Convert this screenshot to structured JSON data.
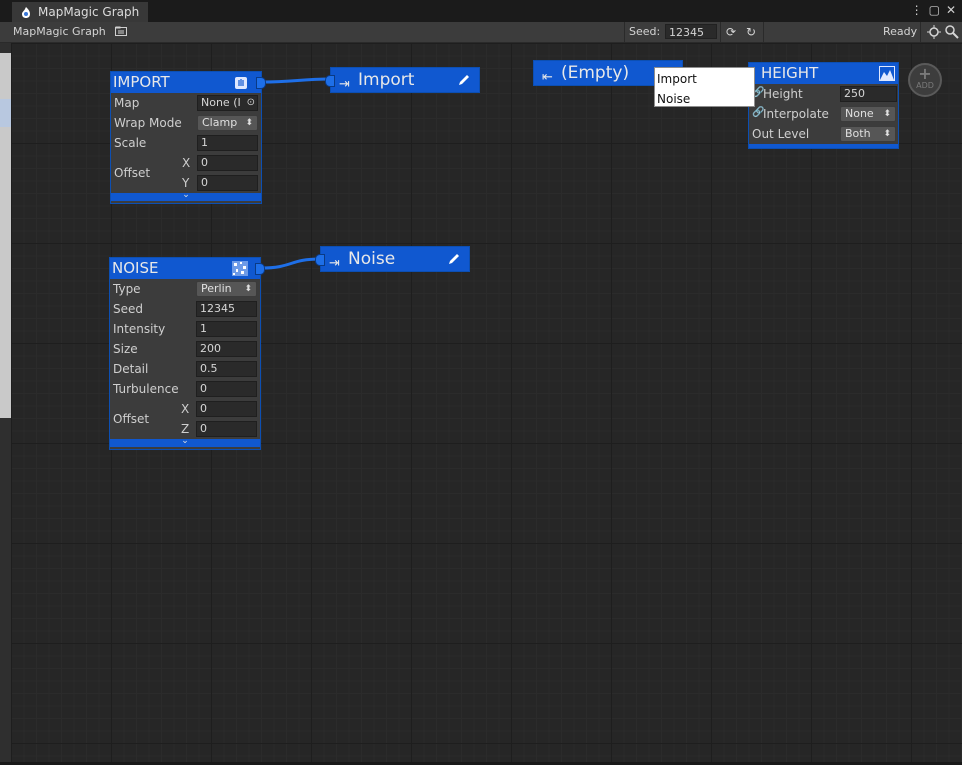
{
  "window": {
    "tab_title": "MapMagic Graph"
  },
  "toolbar": {
    "title": "MapMagic Graph",
    "seed_label": "Seed:",
    "seed_value": "12345",
    "status": "Ready"
  },
  "nodes": {
    "import": {
      "title": "IMPORT",
      "rows": {
        "map_label": "Map",
        "map_value": "None (I",
        "wrap_label": "Wrap Mode",
        "wrap_value": "Clamp",
        "scale_label": "Scale",
        "scale_value": "1",
        "offset_label": "Offset",
        "x_label": "X",
        "x_value": "0",
        "y_label": "Y",
        "y_value": "0"
      }
    },
    "noise": {
      "title": "NOISE",
      "rows": {
        "type_label": "Type",
        "type_value": "Perlin",
        "seed_label": "Seed",
        "seed_value": "12345",
        "intensity_label": "Intensity",
        "intensity_value": "1",
        "size_label": "Size",
        "size_value": "200",
        "detail_label": "Detail",
        "detail_value": "0.5",
        "turbulence_label": "Turbulence",
        "turbulence_value": "0",
        "offset_label": "Offset",
        "x_label": "X",
        "x_value": "0",
        "z_label": "Z",
        "z_value": "0"
      }
    },
    "height": {
      "title": "HEIGHT",
      "rows": {
        "height_label": "Height",
        "height_value": "250",
        "interp_label": "Interpolate",
        "interp_value": "None",
        "outlevel_label": "Out Level",
        "outlevel_value": "Both"
      }
    }
  },
  "portals": {
    "import_out": "Import",
    "noise_out": "Noise",
    "empty_in": "(Empty)"
  },
  "popup": {
    "items": [
      "Import",
      "Noise"
    ]
  },
  "add_button": {
    "label": "ADD"
  },
  "colors": {
    "node_blue": "#1058d0",
    "canvas": "#262626",
    "link": "#1e6fe8"
  }
}
